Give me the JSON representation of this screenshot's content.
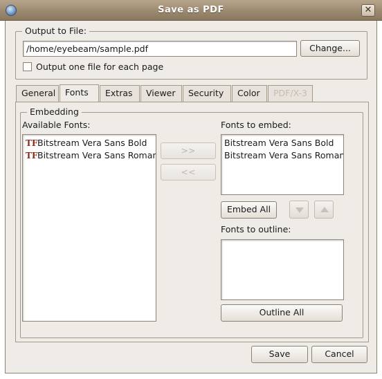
{
  "window": {
    "title": "Save as PDF"
  },
  "output": {
    "group_label": "Output to File:",
    "path": "/home/eyebeam/sample.pdf",
    "change_label": "Change...",
    "one_file_label": "Output one file for each page",
    "one_file_checked": false
  },
  "tabs": [
    {
      "label": "General",
      "active": false,
      "enabled": true
    },
    {
      "label": "Fonts",
      "active": true,
      "enabled": true
    },
    {
      "label": "Extras",
      "active": false,
      "enabled": true
    },
    {
      "label": "Viewer",
      "active": false,
      "enabled": true
    },
    {
      "label": "Security",
      "active": false,
      "enabled": true
    },
    {
      "label": "Color",
      "active": false,
      "enabled": true
    },
    {
      "label": "PDF/X-3",
      "active": false,
      "enabled": false
    }
  ],
  "embedding": {
    "group_label": "Embedding",
    "available_label": "Available Fonts:",
    "available_fonts": [
      "Bitstream Vera Sans Bold",
      "Bitstream Vera Sans Roman"
    ],
    "add_label": ">>",
    "remove_label": "<<",
    "embed_label": "Fonts to embed:",
    "embed_fonts": [
      "Bitstream Vera Sans Bold",
      "Bitstream Vera Sans Roman"
    ],
    "embed_all_label": "Embed All",
    "outline_label": "Fonts to outline:",
    "outline_fonts": [],
    "outline_all_label": "Outline All"
  },
  "footer": {
    "save_label": "Save",
    "cancel_label": "Cancel"
  }
}
